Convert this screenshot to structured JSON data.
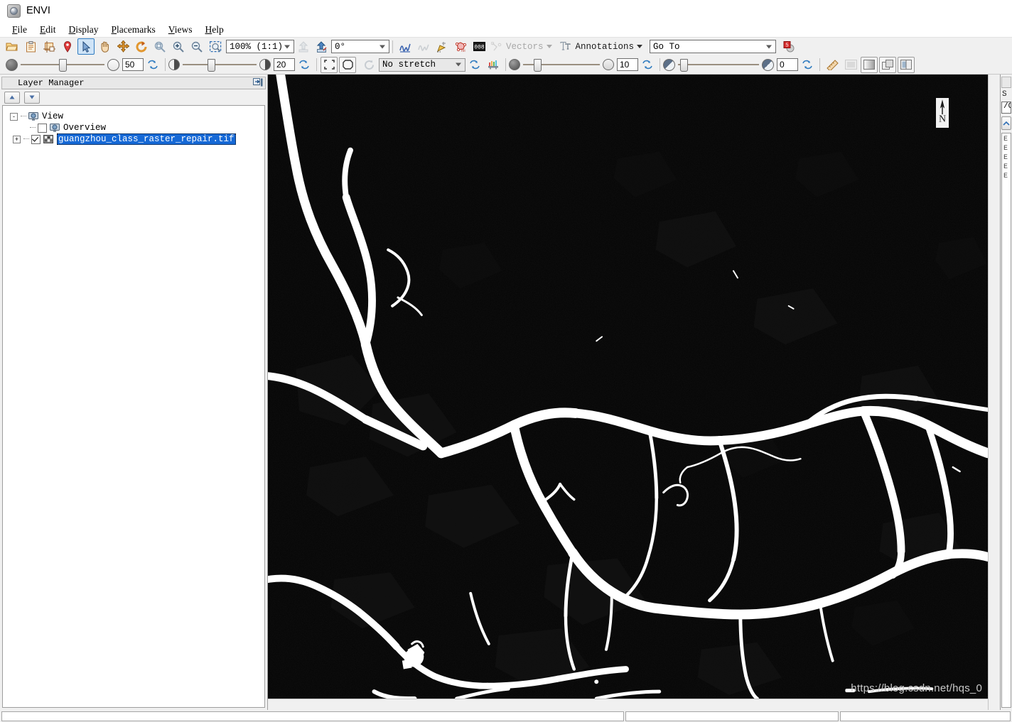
{
  "app": {
    "title": "ENVI",
    "logo_icon": "envi-globe-icon"
  },
  "menubar": {
    "items": [
      {
        "label": "File",
        "accel": "F"
      },
      {
        "label": "Edit",
        "accel": "E"
      },
      {
        "label": "Display",
        "accel": "D"
      },
      {
        "label": "Placemarks",
        "accel": "P"
      },
      {
        "label": "Views",
        "accel": "V"
      },
      {
        "label": "Help",
        "accel": "H"
      }
    ]
  },
  "toolbar_main": {
    "buttons": [
      {
        "name": "open-file-icon",
        "title": "Open"
      },
      {
        "name": "clipboard-icon",
        "title": "Data Manager"
      },
      {
        "name": "crop-region-icon",
        "title": "Subset"
      },
      {
        "name": "placemark-pin-icon",
        "title": "Placemark"
      },
      {
        "name": "select-arrow-icon",
        "title": "Select",
        "active": true
      },
      {
        "name": "pan-hand-icon",
        "title": "Pan"
      },
      {
        "name": "fly-crosshair-icon",
        "title": "Fly"
      },
      {
        "name": "rotate-icon",
        "title": "Rotate"
      },
      {
        "name": "zoom-to-extent-icon",
        "title": "Zoom to Full Extent"
      },
      {
        "name": "zoom-in-icon",
        "title": "Zoom In"
      },
      {
        "name": "zoom-out-icon",
        "title": "Zoom Out"
      },
      {
        "name": "zoom-to-selection-icon",
        "title": "Zoom to Selection"
      }
    ],
    "zoom_value": "100% (1:1)",
    "rotation_value": "0°",
    "nav_buttons": [
      {
        "name": "previous-view-icon",
        "disabled": true
      },
      {
        "name": "next-view-icon",
        "disabled": false
      }
    ],
    "tool_buttons": [
      {
        "name": "spectral-profile-icon",
        "disabled": false
      },
      {
        "name": "horizontal-profile-icon",
        "disabled": true
      },
      {
        "name": "pixel-locator-icon",
        "disabled": false
      },
      {
        "name": "region-of-interest-icon",
        "disabled": false
      },
      {
        "name": "band-threshold-icon",
        "disabled": false
      }
    ],
    "vectors_label": "Vectors",
    "vectors_disabled": true,
    "annotations_label": "Annotations",
    "annotations_disabled": false,
    "goto_placeholder": "Go To",
    "goto_value": "Go To",
    "goto_button": "goto-run-icon"
  },
  "toolbar_display": {
    "transparency": {
      "value": "50",
      "left_icon": "opaque-circle-icon",
      "right_icon": "transparent-circle-icon",
      "reset_icon": "reset-transparency-icon",
      "thumb_pct": 46
    },
    "brightness": {
      "value": "20",
      "left_icon": "brightness-low-icon",
      "right_icon": "brightness-high-icon",
      "reset_icon": "reset-brightness-icon",
      "thumb_pct": 34
    },
    "fit_buttons": [
      {
        "name": "zoom-to-full-extent-icon"
      },
      {
        "name": "zoom-to-layer-extent-icon"
      }
    ],
    "refresh_stretch_icon": "refresh-stretch-icon",
    "stretch_value": "No stretch",
    "stretch_reset_icon": "reset-stretch-icon",
    "histogram_icon": "histogram-stretch-icon",
    "contrast": {
      "value": "10",
      "left_icon": "contrast-low-icon",
      "right_icon": "contrast-high-icon",
      "reset_icon": "reset-contrast-icon",
      "thumb_pct": 30
    },
    "sharpen": {
      "value": "0",
      "left_icon": "sharpen-low-icon",
      "right_icon": "sharpen-high-icon",
      "reset_icon": "reset-sharpen-icon",
      "thumb_pct": 12
    },
    "end_buttons": [
      {
        "name": "measurement-tool-icon"
      },
      {
        "name": "crosshair-cursor-icon",
        "disabled": true
      },
      {
        "name": "single-view-icon",
        "active": true
      },
      {
        "name": "two-view-icon"
      },
      {
        "name": "portal-view-icon"
      }
    ]
  },
  "layer_manager": {
    "title": "Layer Manager",
    "pin_icon": "dock-collapse-icon",
    "move_up_icon": "move-layer-up-icon",
    "move_down_icon": "move-layer-down-icon",
    "tree": {
      "root": {
        "label": "View",
        "icon": "view-monitor-icon",
        "expander": "-"
      },
      "children": [
        {
          "label": "Overview",
          "icon": "view-monitor-icon",
          "checked": false,
          "selected": false,
          "expander": null
        },
        {
          "label": "guangzhou_class_raster_repair.tif",
          "icon": "raster-layer-icon",
          "checked": true,
          "selected": true,
          "expander": "+"
        }
      ]
    }
  },
  "view": {
    "north_arrow_label": "N",
    "watermark": "https://blog.csdn.net/hqs_0",
    "background_color": "#050505",
    "feature_color": "#ffffff"
  },
  "right_panel": {
    "header_icon": "panel-header-icon",
    "label": "S",
    "path_value": "/C",
    "browse_icon": "browse-folder-icon",
    "items": [
      "E",
      "E",
      "E",
      "E",
      "E"
    ]
  },
  "statusbar": {
    "cell1": "",
    "cell2": "",
    "cell3": ""
  }
}
